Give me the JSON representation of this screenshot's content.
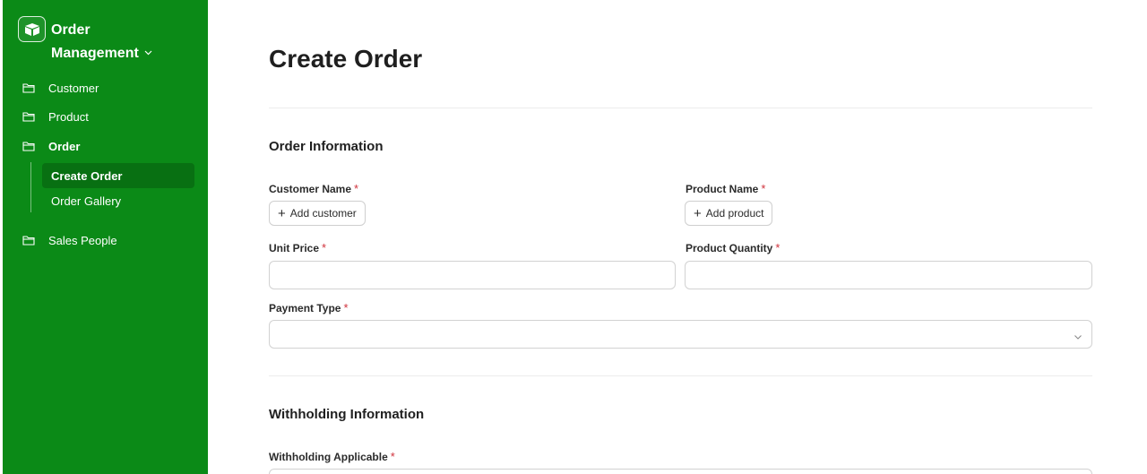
{
  "sidebar": {
    "app_title": "Order Management",
    "items": [
      {
        "label": "Customer"
      },
      {
        "label": "Product"
      },
      {
        "label": "Order"
      },
      {
        "label": "Sales People"
      }
    ],
    "subitems": [
      {
        "label": "Create Order",
        "active": true
      },
      {
        "label": "Order Gallery",
        "active": false
      }
    ]
  },
  "main": {
    "page_title": "Create Order",
    "sections": {
      "order_info": "Order Information",
      "withholding_info": "Withholding Information"
    },
    "fields": {
      "customer_name": {
        "label": "Customer Name",
        "button": "Add customer"
      },
      "product_name": {
        "label": "Product Name",
        "button": "Add product"
      },
      "unit_price": {
        "label": "Unit Price",
        "value": ""
      },
      "product_quantity": {
        "label": "Product Quantity",
        "value": ""
      },
      "payment_type": {
        "label": "Payment Type",
        "value": ""
      },
      "withholding_applicable": {
        "label": "Withholding Applicable"
      }
    },
    "required_marker": "*"
  },
  "colors": {
    "sidebar_bg": "#0b8a17",
    "active_item_bg": "#087012",
    "required": "#d0323c"
  }
}
